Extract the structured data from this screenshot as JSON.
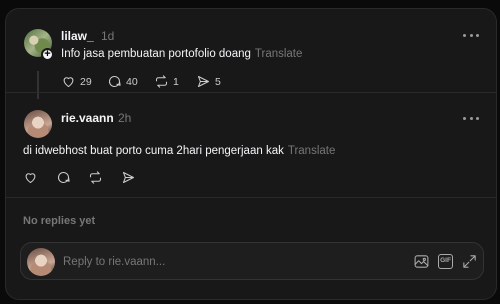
{
  "post": {
    "username": "lilaw_",
    "time": "1d",
    "text": "Info jasa pembuatan portofolio doang",
    "translate": "Translate",
    "likes": "29",
    "comments": "40",
    "reposts": "1",
    "shares": "5"
  },
  "reply": {
    "username": "rie.vaann",
    "time": "2h",
    "text": "di idwebhost buat porto cuma 2hari pengerjaan kak",
    "translate": "Translate"
  },
  "replies_status": "No replies yet",
  "composer": {
    "placeholder": "Reply to rie.vaann...",
    "gif_label": "GIF"
  },
  "icons": {
    "add": "plus-icon",
    "like": "heart-icon",
    "comment": "comment-icon",
    "repost": "repost-icon",
    "share": "send-icon",
    "more": "more-icon",
    "image": "image-icon",
    "gif": "gif-icon",
    "expand": "expand-icon"
  }
}
